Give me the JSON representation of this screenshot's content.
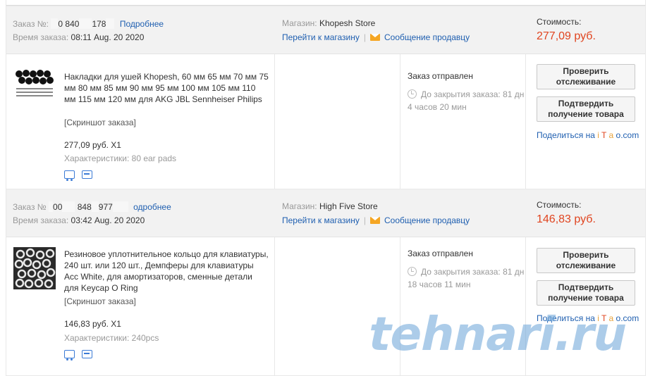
{
  "orders": [
    {
      "order_label": "Заказ №:",
      "order_number_visible": [
        "0",
        "840",
        "178"
      ],
      "details_link": "Подробнее",
      "time_label": "Время заказа:",
      "time_value": "08:11 Aug. 20 2020",
      "store_label": "Магазин:",
      "store_name": "Khopesh Store",
      "go_to_store": "Перейти к магазину",
      "message_seller": "Сообщение продавцу",
      "cost_label": "Стоимость:",
      "cost_value": "277,09 руб.",
      "item_title": "Накладки для ушей Khopesh, 60 мм 65 мм 70 мм 75 мм 80 мм 85 мм 90 мм 95 мм 100 мм 105 мм 110 мм 115 мм 120 мм для AKG JBL Sennheiser Philips",
      "snapshot": "[Скриншот заказа]",
      "qty_price": "277,09 руб. X1",
      "attr_label": "Характеристики:",
      "attr_value": "80 ear pads",
      "status": "Заказ отправлен",
      "countdown": "До закрытия заказа: 81 дн 4 часов 20 мин",
      "btn_track": "Проверить отслеживание",
      "btn_confirm": "Подтвердить получение товара",
      "share_prefix": "Поделиться на",
      "share_i": "i",
      "share_t": "T",
      "share_a": "a",
      "share_o": "o.com"
    },
    {
      "order_label": "Заказ №",
      "order_number_visible": [
        "00",
        "848",
        "977"
      ],
      "details_link": "одробнее",
      "time_label": "Время заказа:",
      "time_value": "03:42 Aug. 20 2020",
      "store_label": "Магазин:",
      "store_name": "High Five Store",
      "go_to_store": "Перейти к магазину",
      "message_seller": "Сообщение продавцу",
      "cost_label": "Стоимость:",
      "cost_value": "146,83 руб.",
      "item_title": "Резиновое уплотнительное кольцо для клавиатуры, 240 шт. или 120 шт., Демпферы для клавиатуры Acc White, для амортизаторов, сменные детали для Keycap O Ring",
      "snapshot": "[Скриншот заказа]",
      "qty_price": "146,83 руб. X1",
      "attr_label": "Характеристики:",
      "attr_value": "240pcs",
      "status": "Заказ отправлен",
      "countdown": "До закрытия заказа: 81 дн 18 часов 11 мин",
      "btn_track": "Проверить отслеживание",
      "btn_confirm": "Подтвердить получение товара",
      "share_prefix": "Поделиться на",
      "share_i": "i",
      "share_t": "T",
      "share_a": "a",
      "share_o": "o.com"
    }
  ],
  "watermark": "tehnari.ru",
  "colors": {
    "link": "#1f5fb0",
    "price": "#e0441f",
    "header_bg": "#f2f2f2"
  }
}
